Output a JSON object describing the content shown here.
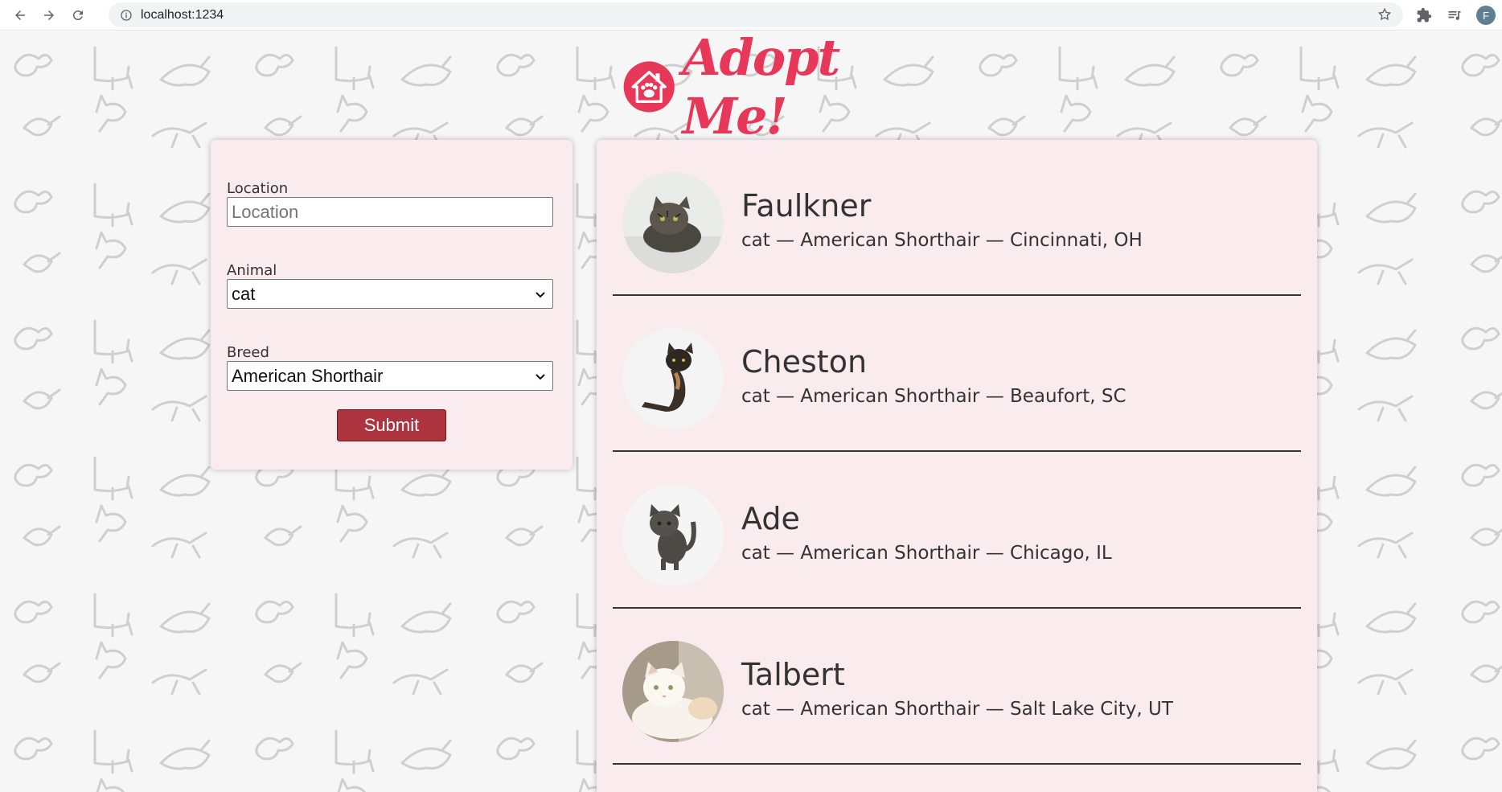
{
  "browser": {
    "url": "localhost:1234",
    "profile_initial": "F"
  },
  "header": {
    "logo_text": "Adopt Me!"
  },
  "search": {
    "location_label": "Location",
    "location_placeholder": "Location",
    "location_value": "",
    "animal_label": "Animal",
    "animal_value": "cat",
    "breed_label": "Breed",
    "breed_value": "American Shorthair",
    "submit_label": "Submit"
  },
  "pets": [
    {
      "name": "Faulkner",
      "info": "cat — American Shorthair — Cincinnati, OH",
      "photo": "tabby-cat-photo"
    },
    {
      "name": "Cheston",
      "info": "cat — American Shorthair — Beaufort, SC",
      "photo": "tortoiseshell-kitten-photo"
    },
    {
      "name": "Ade",
      "info": "cat — American Shorthair — Chicago, IL",
      "photo": "gray-kitten-photo"
    },
    {
      "name": "Talbert",
      "info": "cat — American Shorthair — Salt Lake City, UT",
      "photo": "white-cat-photo"
    }
  ],
  "colors": {
    "brand": "#e8385a",
    "button": "#ad343e",
    "card": "#faebee"
  }
}
